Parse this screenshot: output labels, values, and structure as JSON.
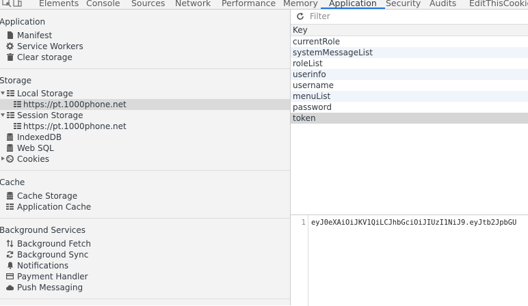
{
  "tabs": [
    {
      "label": "Elements"
    },
    {
      "label": "Console"
    },
    {
      "label": "Sources"
    },
    {
      "label": "Network"
    },
    {
      "label": "Performance"
    },
    {
      "label": "Memory"
    },
    {
      "label": "Application"
    },
    {
      "label": "Security"
    },
    {
      "label": "Audits"
    },
    {
      "label": "EditThisCookie"
    }
  ],
  "active_tab": "Application",
  "sidebar": {
    "application": {
      "title": "Application",
      "items": [
        {
          "label": "Manifest",
          "icon": "document-icon"
        },
        {
          "label": "Service Workers",
          "icon": "gear-icon"
        },
        {
          "label": "Clear storage",
          "icon": "trash-icon"
        }
      ]
    },
    "storage": {
      "title": "Storage",
      "local_storage": {
        "label": "Local Storage",
        "child": "https://pt.1000phone.net"
      },
      "session_storage": {
        "label": "Session Storage",
        "child": "https://pt.1000phone.net"
      },
      "indexeddb": "IndexedDB",
      "websql": "Web SQL",
      "cookies": "Cookies"
    },
    "cache": {
      "title": "Cache",
      "items": [
        {
          "label": "Cache Storage",
          "icon": "database-icon"
        },
        {
          "label": "Application Cache",
          "icon": "grid-icon"
        }
      ]
    },
    "background": {
      "title": "Background Services",
      "items": [
        {
          "label": "Background Fetch",
          "icon": "arrows-updown-icon"
        },
        {
          "label": "Background Sync",
          "icon": "sync-icon"
        },
        {
          "label": "Notifications",
          "icon": "bell-icon"
        },
        {
          "label": "Payment Handler",
          "icon": "card-icon"
        },
        {
          "label": "Push Messaging",
          "icon": "cloud-icon"
        }
      ]
    }
  },
  "filter": {
    "placeholder": "Filter",
    "value": ""
  },
  "table": {
    "header": "Key",
    "keys": [
      "currentRole",
      "systemMessageList",
      "roleList",
      "userinfo",
      "username",
      "menuList",
      "password",
      "token"
    ],
    "selected_key": "token"
  },
  "value": {
    "line_number": "1",
    "text": "eyJ0eXAiOiJKV1QiLCJhbGciOiJIUzI1NiJ9.eyJtb2JpbGU"
  },
  "colors": {
    "accent": "#1a73e8",
    "sidebar_bg": "#f3f3f3",
    "row_selected": "#dadada",
    "row_alt": "#f0f4fb"
  }
}
